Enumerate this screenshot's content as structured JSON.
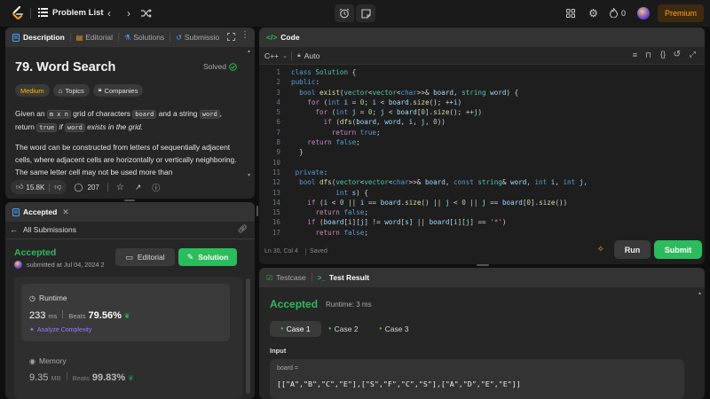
{
  "topbar": {
    "title": "Problem List",
    "streak": "0",
    "premium": "Premium"
  },
  "desc_tabs": {
    "description": "Description",
    "editorial": "Editorial",
    "solutions": "Solutions",
    "submissions": "Submissio"
  },
  "problem": {
    "title": "79. Word Search",
    "status": "Solved",
    "difficulty": "Medium",
    "topics": "Topics",
    "companies": "Companies",
    "p1_a": "Given an ",
    "p1_code1": "m x n",
    "p1_b": " grid of characters ",
    "p1_code2": "board",
    "p1_c": " and a string ",
    "p1_code3": "word",
    "p1_d": ",",
    "p1_e": "return ",
    "p1_code4": "true",
    "p1_f": " if ",
    "p1_code5": "word",
    "p1_g": " exists in the grid.",
    "p2": "The word can be constructed from letters of sequentially adjacent cells, where adjacent cells are horizontally or vertically neighboring. The same letter cell may not be used more than",
    "likes": "15.8K",
    "comments": "207"
  },
  "accepted_panel": {
    "tab": "Accepted",
    "all_submissions": "All Submissions",
    "status": "Accepted",
    "submitted_at": "submitted at Jul 04, 2024 2",
    "editorial_btn": "Editorial",
    "solution_btn": "Solution",
    "runtime_label": "Runtime",
    "runtime_value": "233",
    "runtime_unit": "ms",
    "beats_label": "Beats",
    "runtime_beats": "79.56%",
    "analyze": "Analyze Complexity",
    "memory_label": "Memory",
    "memory_value": "9.35",
    "memory_unit": "MB",
    "memory_beats": "99.83%"
  },
  "code_panel": {
    "title": "Code",
    "language": "C++",
    "autosave": "Auto",
    "cursor": "Ln 30, Col 4",
    "saved": "Saved",
    "run": "Run",
    "submit": "Submit"
  },
  "result_panel": {
    "testcase_tab": "Testcase",
    "result_tab": "Test Result",
    "status": "Accepted",
    "runtime": "Runtime: 3 ms",
    "case1": "Case 1",
    "case2": "Case 2",
    "case3": "Case 3",
    "input_label": "Input",
    "var_name": "board =",
    "var_value": "[[\"A\",\"B\",\"C\",\"E\"],[\"S\",\"F\",\"C\",\"S\"],[\"A\",\"D\",\"E\",\"E\"]]"
  },
  "colors": {
    "accent_green": "#2cbb5d",
    "medium": "#ffb800",
    "premium": "#ffa116",
    "panel": "#262626",
    "background": "#0f0f0f"
  }
}
